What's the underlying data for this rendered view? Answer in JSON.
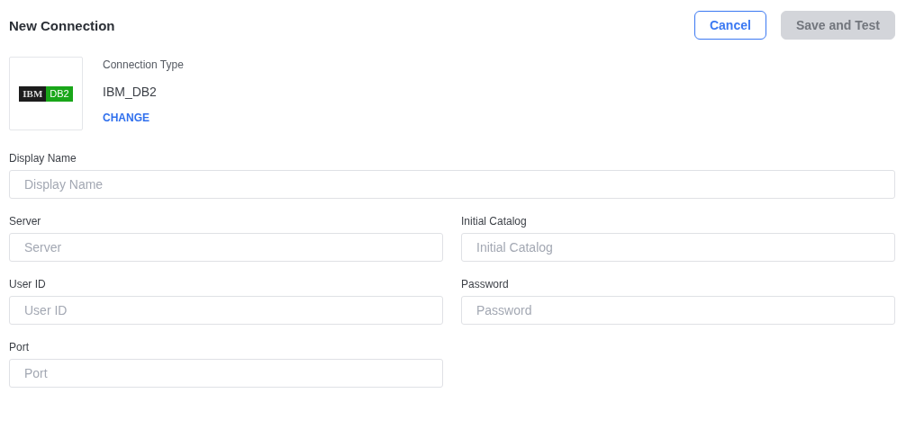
{
  "title": "New Connection",
  "buttons": [
    {
      "label": "Cancel",
      "kind": "secondary"
    },
    {
      "label": "Save and Test",
      "kind": "primary",
      "disabled": true
    }
  ],
  "connection_type": {
    "logo": {
      "left": "IBM",
      "right": "DB2"
    },
    "label": "Connection Type",
    "value": "IBM_DB2",
    "action": "CHANGE"
  },
  "fields": [
    {
      "label": "Display Name",
      "placeholder": "Display Name",
      "wide": true
    },
    {
      "label": "Server",
      "placeholder": "Server",
      "wide": false
    },
    {
      "label": "Initial Catalog",
      "placeholder": "Initial Catalog",
      "wide": false
    },
    {
      "label": "User ID",
      "placeholder": "User ID",
      "wide": false
    },
    {
      "label": "Password",
      "placeholder": "Password",
      "wide": false
    },
    {
      "label": "Port",
      "placeholder": "Port",
      "wide": false
    }
  ]
}
